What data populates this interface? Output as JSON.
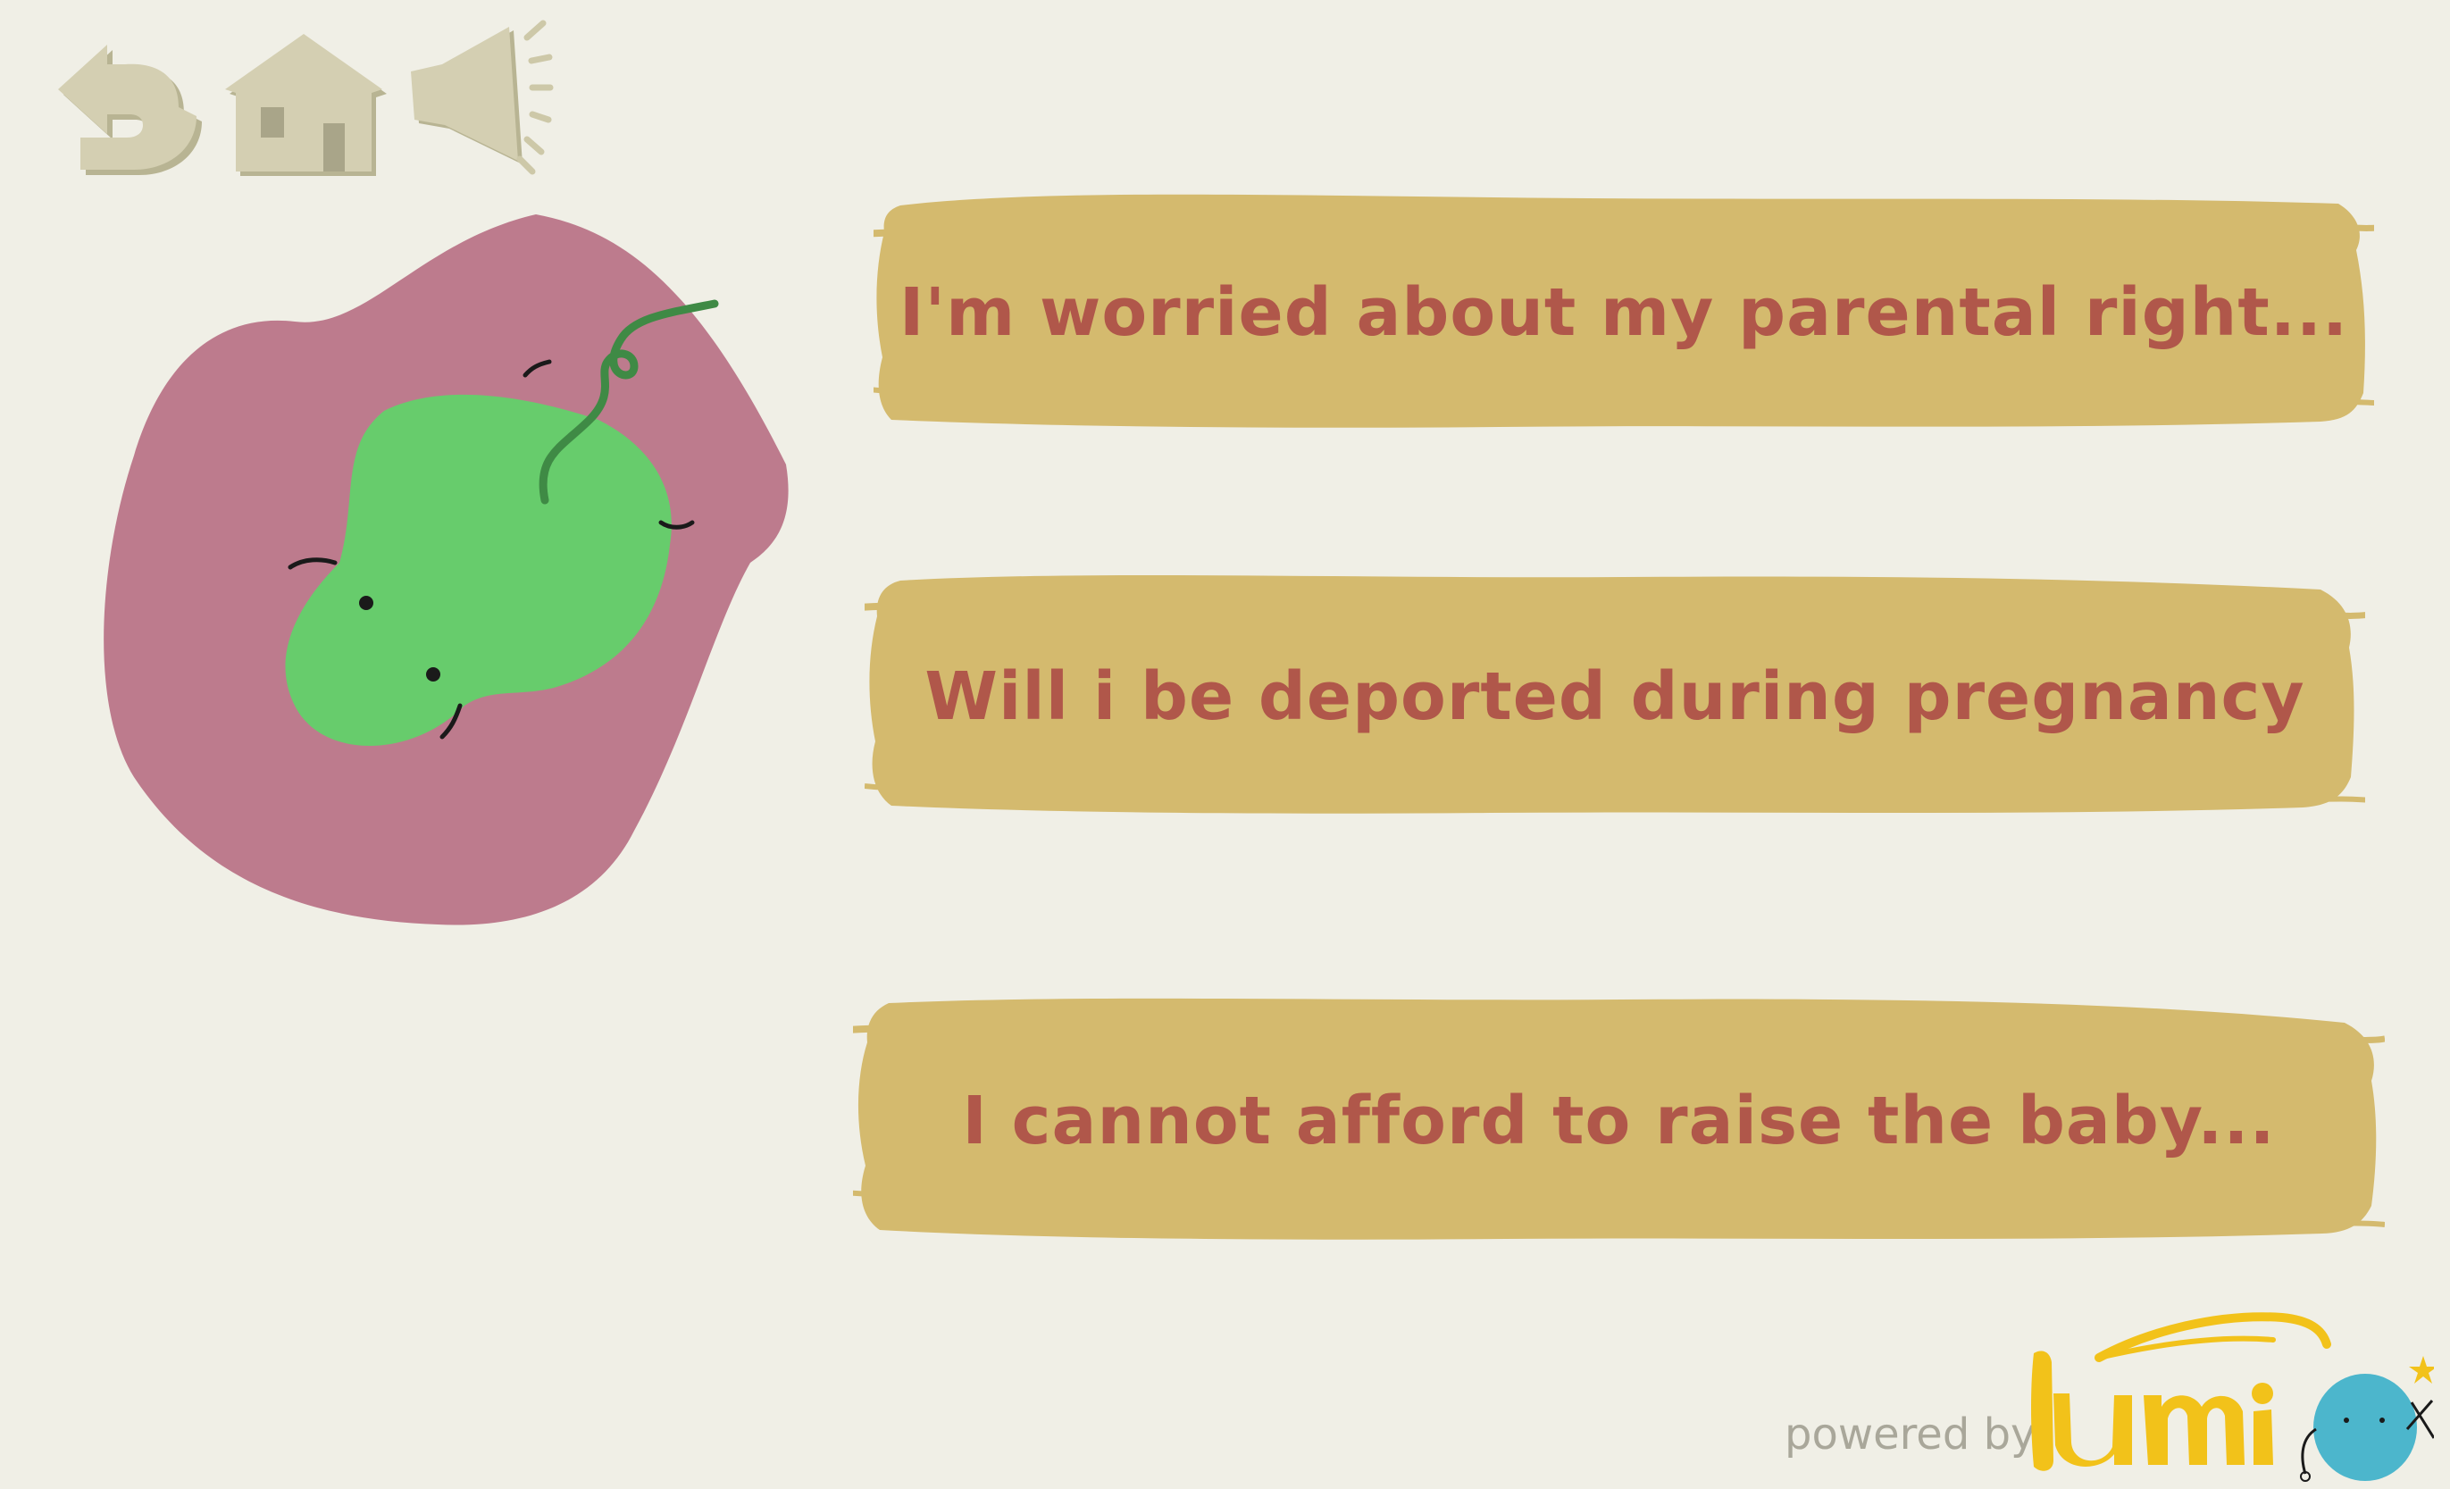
{
  "options": [
    {
      "label": "I'm worried about my parental right..."
    },
    {
      "label": "Will i be deported during pregnancy"
    },
    {
      "label": "I cannot afford to raise the baby..."
    }
  ],
  "branding": {
    "powered_by": "powered by",
    "logo_text": "lumi"
  },
  "colors": {
    "background": "#f0efe6",
    "button_fill": "#d4ba6e",
    "button_text": "#b0574a",
    "nav_icon": "#cdc8a8",
    "blob_pink": "#bd7b8d",
    "blob_green": "#67cc6c",
    "logo_yellow": "#f2c21a",
    "logo_blue": "#4cb6cc"
  },
  "icons": {
    "back": "back-arrow-icon",
    "home": "home-icon",
    "sound": "speaker-icon"
  }
}
